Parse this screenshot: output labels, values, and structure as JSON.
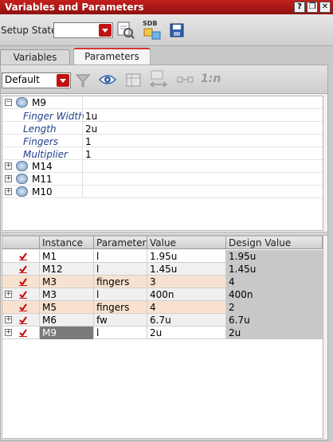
{
  "window": {
    "title": "Variables and Parameters",
    "buttons": [
      "?",
      "❐",
      "✕"
    ]
  },
  "toolbar": {
    "setup_state_label": "Setup State:",
    "setup_state_value": ""
  },
  "tabs": [
    {
      "label": "Variables"
    },
    {
      "label": "Parameters"
    }
  ],
  "filter": {
    "selected": "Default",
    "icon_1n_label": "1:n"
  },
  "tree": [
    {
      "name": "M9",
      "expanded": true,
      "params": [
        {
          "name": "Finger Width",
          "value": "1u"
        },
        {
          "name": "Length",
          "value": "2u"
        },
        {
          "name": "Fingers",
          "value": "1"
        },
        {
          "name": "Multiplier",
          "value": "1"
        }
      ]
    },
    {
      "name": "M14",
      "expanded": false
    },
    {
      "name": "M11",
      "expanded": false
    },
    {
      "name": "M10",
      "expanded": false
    }
  ],
  "grid": {
    "columns": [
      "Instance ▲",
      "Parameter",
      "Value",
      "Design Value"
    ],
    "rows": [
      {
        "instance": "M1",
        "parameter": "l",
        "value": "1.95u",
        "design": "1.95u",
        "highlight": false,
        "expand": false
      },
      {
        "instance": "M12",
        "parameter": "l",
        "value": "1.45u",
        "design": "1.45u",
        "highlight": false,
        "expand": false
      },
      {
        "instance": "M3",
        "parameter": "fingers",
        "value": "3",
        "design": "4",
        "highlight": true,
        "expand": false
      },
      {
        "instance": "M3",
        "parameter": "l",
        "value": "400n",
        "design": "400n",
        "highlight": false,
        "expand": true
      },
      {
        "instance": "M5",
        "parameter": "fingers",
        "value": "4",
        "design": "2",
        "highlight": true,
        "expand": false
      },
      {
        "instance": "M6",
        "parameter": "fw",
        "value": "6.7u",
        "design": "6.7u",
        "highlight": false,
        "expand": true
      },
      {
        "instance": "M9",
        "parameter": "l",
        "value": "2u",
        "design": "2u",
        "highlight": false,
        "expand": true,
        "selected": true
      }
    ]
  }
}
